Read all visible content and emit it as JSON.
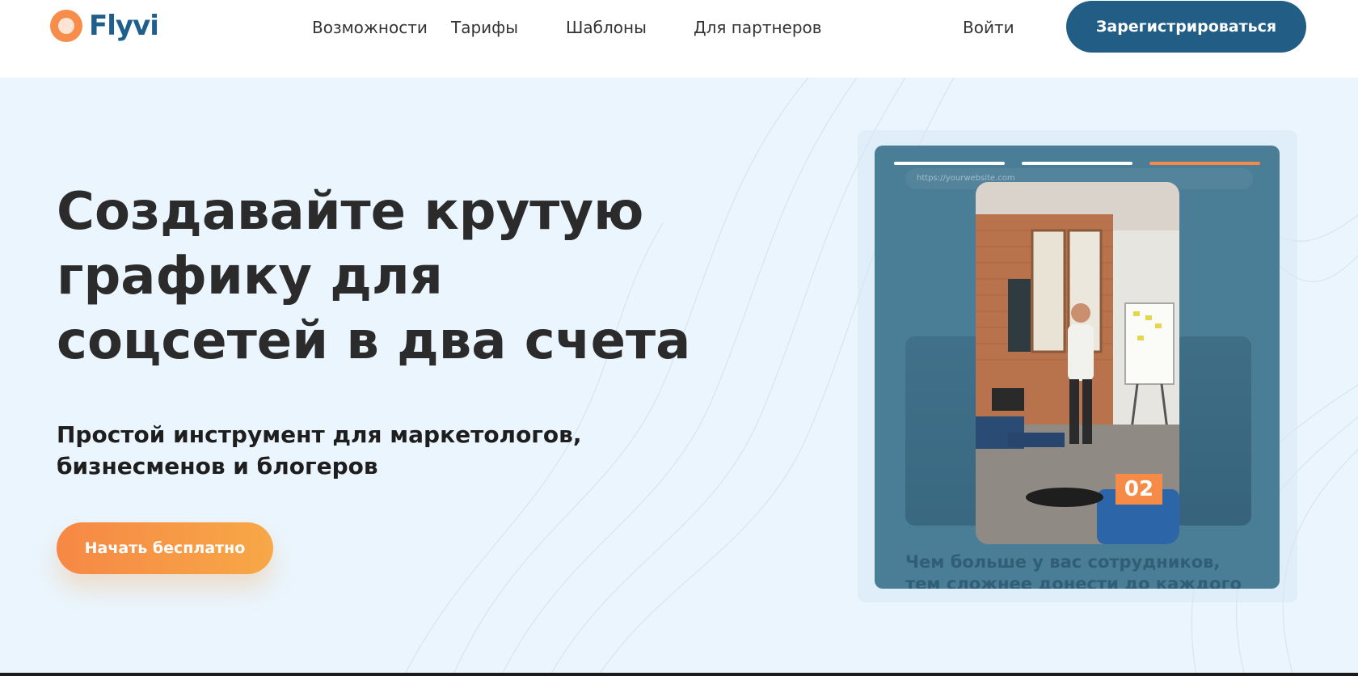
{
  "header": {
    "logo_text": "Flyvi",
    "nav": [
      {
        "label": "Возможности"
      },
      {
        "label": "Тарифы"
      },
      {
        "label": "Шаблоны"
      },
      {
        "label": "Для партнеров"
      }
    ],
    "login_label": "Войти",
    "signup_label": "Зарегистрироваться"
  },
  "hero": {
    "title": "Создавайте крутую графику для соцсетей в два счета",
    "subtitle": "Простой инструмент для маркетологов, бизнесменов и блогеров",
    "cta_label": "Начать бесплатно"
  },
  "mockup": {
    "url": "https://yourwebsite.com",
    "story_number": "02",
    "caption": "Чем больше у вас сотрудников, тем сложнее донести до каждого"
  },
  "colors": {
    "brand_dark": "#215d85",
    "accent_orange": "#f68d4a",
    "hero_bg": "#eaf5fd",
    "mock_card": "#4a7d96"
  }
}
